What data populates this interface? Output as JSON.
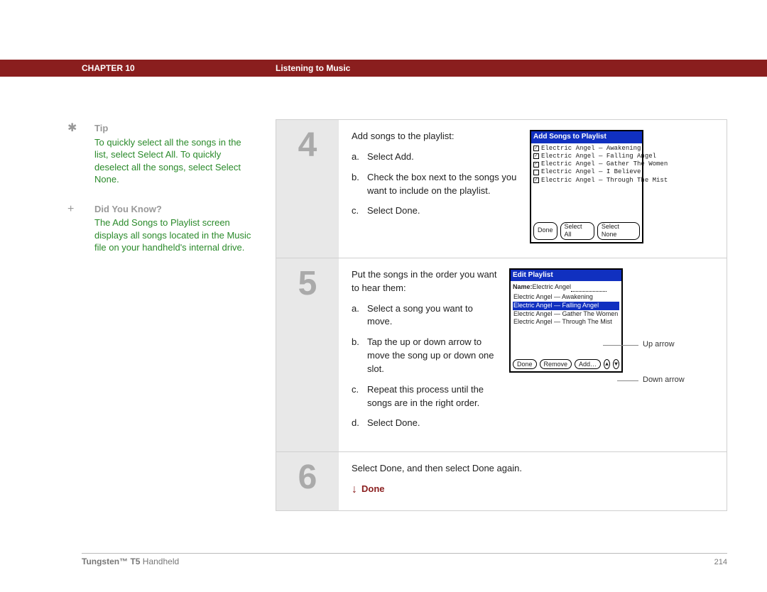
{
  "header": {
    "chapter": "CHAPTER 10",
    "title": "Listening to Music"
  },
  "sidebar": {
    "tip": {
      "icon": "✱",
      "heading": "Tip",
      "body": "To quickly select all the songs in the list, select Select All. To quickly deselect all the songs, select Select None."
    },
    "dyk": {
      "icon": "+",
      "heading": "Did You Know?",
      "body": "The Add Songs to Playlist screen displays all songs located in the Music file on your handheld's internal drive."
    }
  },
  "steps": [
    {
      "num": "4",
      "intro": "Add songs to the playlist:",
      "subs": [
        {
          "l": "a.",
          "t": "Select Add."
        },
        {
          "l": "b.",
          "t": "Check the box next to the songs you want to include on the playlist."
        },
        {
          "l": "c.",
          "t": "Select Done."
        }
      ],
      "pda": {
        "title": "Add Songs to Playlist",
        "songs": [
          {
            "c": true,
            "t": "Electric Angel — Awakening"
          },
          {
            "c": true,
            "t": "Electric Angel — Falling Angel"
          },
          {
            "c": true,
            "t": "Electric Angel — Gather The Women"
          },
          {
            "c": false,
            "t": "Electric Angel — I Believe"
          },
          {
            "c": true,
            "t": "Electric Angel — Through The Mist"
          }
        ],
        "buttons": [
          "Done",
          "Select All",
          "Select None"
        ]
      }
    },
    {
      "num": "5",
      "intro": "Put the songs in the order you want to hear them:",
      "subs": [
        {
          "l": "a.",
          "t": "Select a song you want to move."
        },
        {
          "l": "b.",
          "t": "Tap the up or down arrow to move the song up or down one slot."
        },
        {
          "l": "c.",
          "t": "Repeat this process until the songs are in the right order."
        },
        {
          "l": "d.",
          "t": "Select Done."
        }
      ],
      "pda": {
        "title": "Edit Playlist",
        "name_label": "Name:",
        "name_value": "Electric Angel",
        "rows": [
          {
            "t": "Electric Angel — Awakening",
            "sel": false
          },
          {
            "t": "Electric Angel — Falling Angel",
            "sel": true
          },
          {
            "t": "Electric Angel — Gather The Women",
            "sel": false
          },
          {
            "t": "Electric Angel — Through The Mist",
            "sel": false
          }
        ],
        "buttons": [
          "Done",
          "Remove",
          "Add…"
        ],
        "callouts": {
          "up": "Up arrow",
          "down": "Down arrow"
        }
      }
    },
    {
      "num": "6",
      "intro": "Select Done, and then select Done again.",
      "done_label": "Done"
    }
  ],
  "footer": {
    "brand_bold": "Tungsten™ T5",
    "brand_rest": " Handheld",
    "page": "214"
  }
}
